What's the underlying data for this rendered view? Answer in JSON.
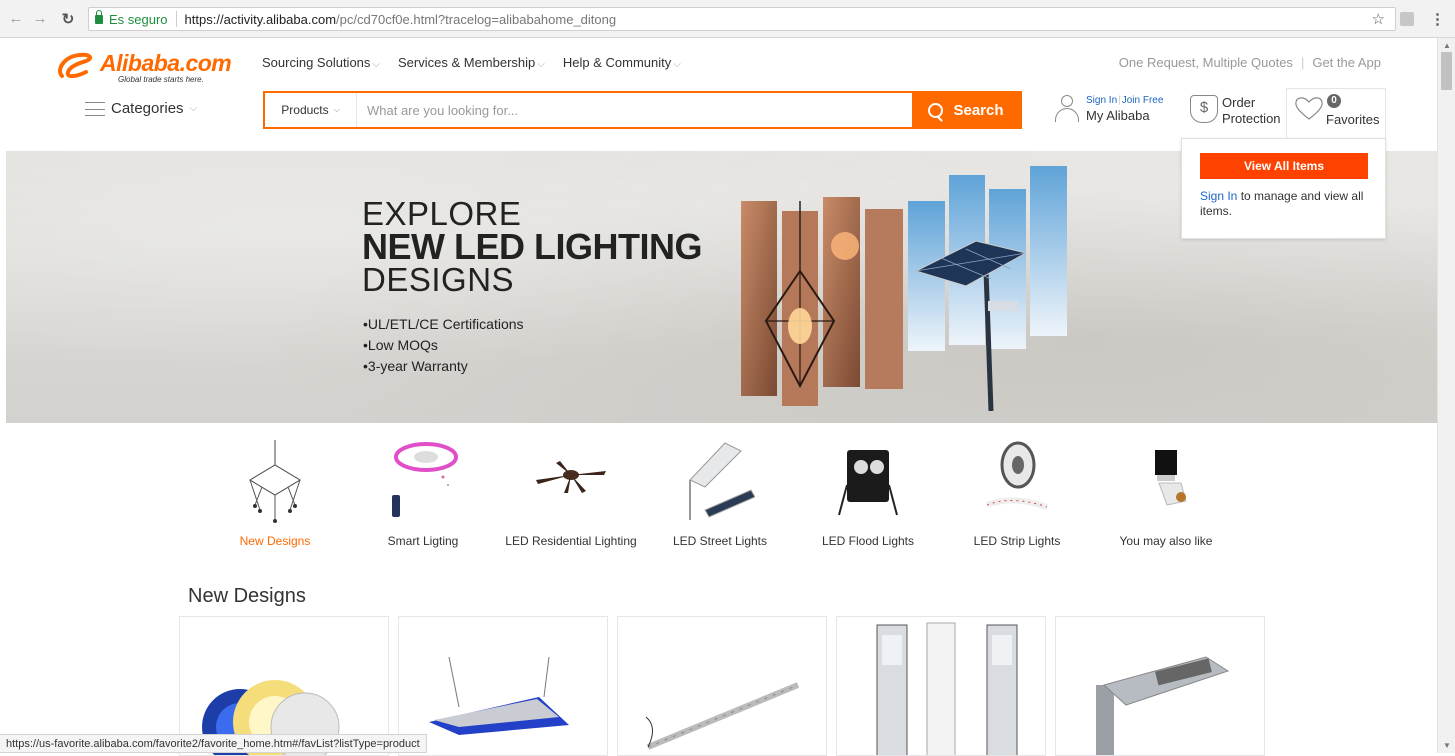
{
  "browser": {
    "secure_label": "Es seguro",
    "url_host": "https://activity.alibaba.com",
    "url_path": "/pc/cd70cf0e.html?tracelog=alibabahome_ditong",
    "status_url": "https://us-favorite.alibaba.com/favorite2/favorite_home.htm#/favList?listType=product"
  },
  "header": {
    "logo_text": "Alibaba.com",
    "logo_tagline": "Global trade starts here.",
    "nav": [
      "Sourcing Solutions",
      "Services & Membership",
      "Help & Community"
    ],
    "top_links": [
      "One Request, Multiple Quotes",
      "Get the App"
    ],
    "categories_label": "Categories",
    "search": {
      "scope": "Products",
      "placeholder": "What are you looking for...",
      "button": "Search"
    },
    "account": {
      "sign_in": "Sign In",
      "join_free": "Join Free",
      "my_alibaba": "My Alibaba"
    },
    "order_protection": {
      "line1": "Order",
      "line2": "Protection"
    },
    "favorites": {
      "count": "0",
      "label": "Favorites"
    }
  },
  "favorites_popup": {
    "button": "View All Items",
    "sign_in": "Sign In",
    "message": " to manage and view all items."
  },
  "hero": {
    "line1": "EXPLORE",
    "line2": "NEW LED LIGHTING",
    "line3": "DESIGNS",
    "bullets": [
      "UL/ETL/CE Certifications",
      "Low MOQs",
      "3-year Warranty"
    ]
  },
  "categories": [
    {
      "label": "New Designs",
      "active": true
    },
    {
      "label": "Smart Ligting",
      "active": false
    },
    {
      "label": "LED Residential Lighting",
      "active": false
    },
    {
      "label": "LED Street Lights",
      "active": false
    },
    {
      "label": "LED Flood Lights",
      "active": false
    },
    {
      "label": "LED Strip Lights",
      "active": false
    },
    {
      "label": "You may also like",
      "active": false
    }
  ],
  "section_title": "New Designs",
  "colors": {
    "brand_orange": "#ff6a00",
    "link_blue": "#1a66c4"
  }
}
